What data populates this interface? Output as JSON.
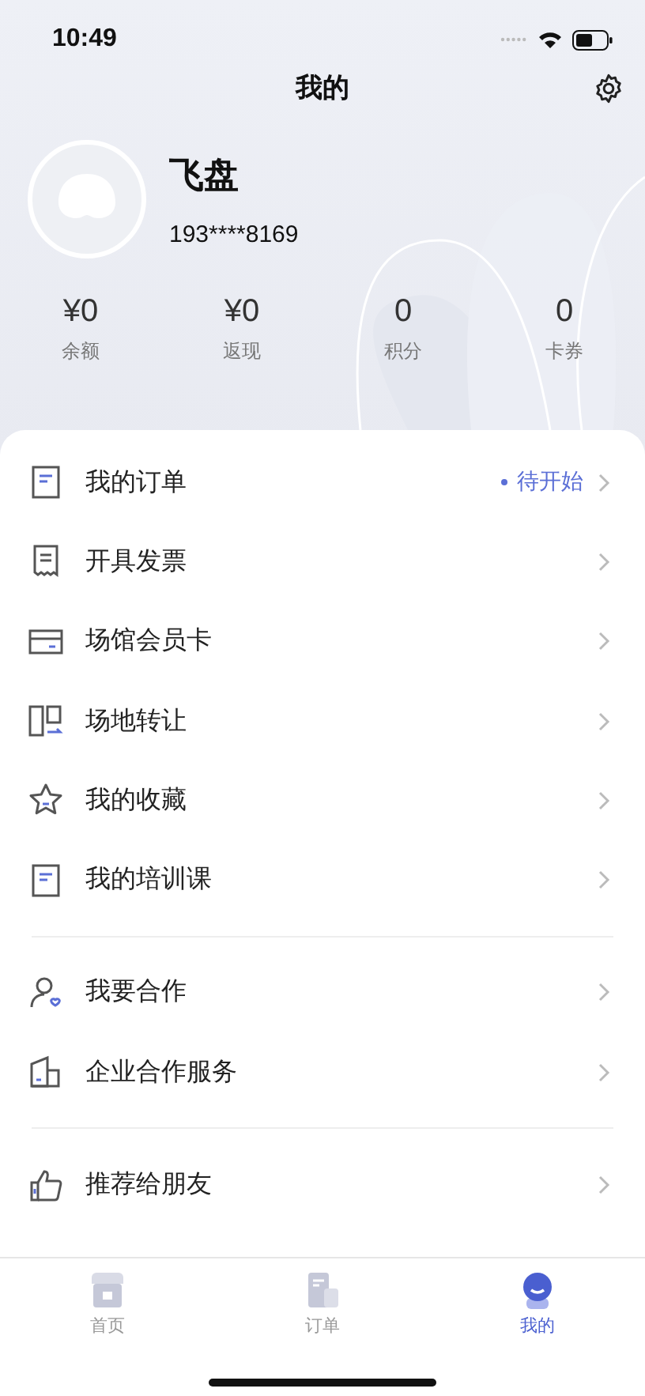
{
  "status_bar": {
    "time": "10:49"
  },
  "header": {
    "title": "我的"
  },
  "profile": {
    "name": "飞盘",
    "phone": "193****8169"
  },
  "stats": [
    {
      "value": "¥0",
      "label": "余额"
    },
    {
      "value": "¥0",
      "label": "返现"
    },
    {
      "value": "0",
      "label": "积分"
    },
    {
      "value": "0",
      "label": "卡券"
    }
  ],
  "menu_groups": [
    {
      "items": [
        {
          "kind": "order",
          "label": "我的订单",
          "status": "待开始"
        },
        {
          "kind": "invoice",
          "label": "开具发票"
        },
        {
          "kind": "card",
          "label": "场馆会员卡"
        },
        {
          "kind": "transfer",
          "label": "场地转让"
        },
        {
          "kind": "star",
          "label": "我的收藏"
        },
        {
          "kind": "order",
          "label": "我的培训课"
        }
      ]
    },
    {
      "items": [
        {
          "kind": "partner",
          "label": "我要合作"
        },
        {
          "kind": "building",
          "label": "企业合作服务"
        }
      ]
    },
    {
      "items": [
        {
          "kind": "thumb",
          "label": "推荐给朋友"
        }
      ]
    }
  ],
  "tab_bar": [
    {
      "kind": "home",
      "label": "首页",
      "selected": false
    },
    {
      "kind": "order",
      "label": "订单",
      "selected": false
    },
    {
      "kind": "me",
      "label": "我的",
      "selected": true
    }
  ]
}
